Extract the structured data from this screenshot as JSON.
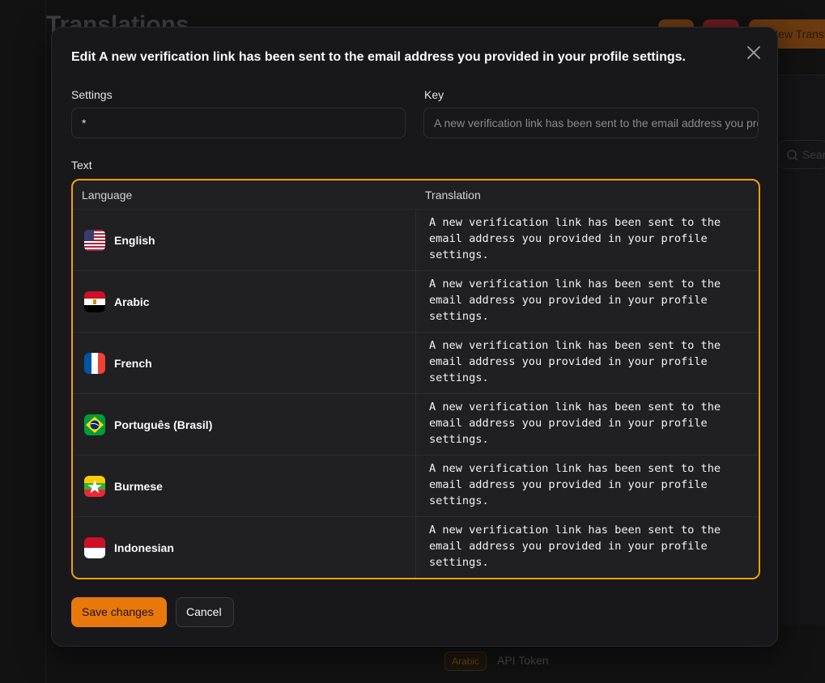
{
  "background": {
    "page_title": "Translations",
    "new_button_label": "New Translation",
    "search_placeholder": "Search",
    "row_badge": "Arabic",
    "row_text": "API Token"
  },
  "modal": {
    "title": "Edit A new verification link has been sent to the email address you provided in your profile settings.",
    "settings_label": "Settings",
    "settings_value": "*",
    "key_label": "Key",
    "key_placeholder": "A new verification link has been sent to the email address you provided in your profile settings.",
    "text_label": "Text",
    "columns": {
      "language": "Language",
      "translation": "Translation"
    },
    "rows": [
      {
        "language": "English",
        "flag": "us-flag",
        "translation": "A new verification link has been sent to the email address you provided in your profile settings."
      },
      {
        "language": "Arabic",
        "flag": "egypt-flag",
        "translation": "A new verification link has been sent to the email address you provided in your profile settings."
      },
      {
        "language": "French",
        "flag": "france-flag",
        "translation": "A new verification link has been sent to the email address you provided in your profile settings."
      },
      {
        "language": "Português (Brasil)",
        "flag": "brazil-flag",
        "translation": "A new verification link has been sent to the email address you provided in your profile settings."
      },
      {
        "language": "Burmese",
        "flag": "myanmar-flag",
        "translation": "A new verification link has been sent to the email address you provided in your profile settings."
      },
      {
        "language": "Indonesian",
        "flag": "indonesia-flag",
        "translation": "A new verification link has been sent to the email address you provided in your profile settings."
      }
    ],
    "save_label": "Save changes",
    "cancel_label": "Cancel"
  },
  "colors": {
    "accent": "#f59e0b",
    "primary_button": "#e9780c",
    "surface": "#18181b"
  }
}
